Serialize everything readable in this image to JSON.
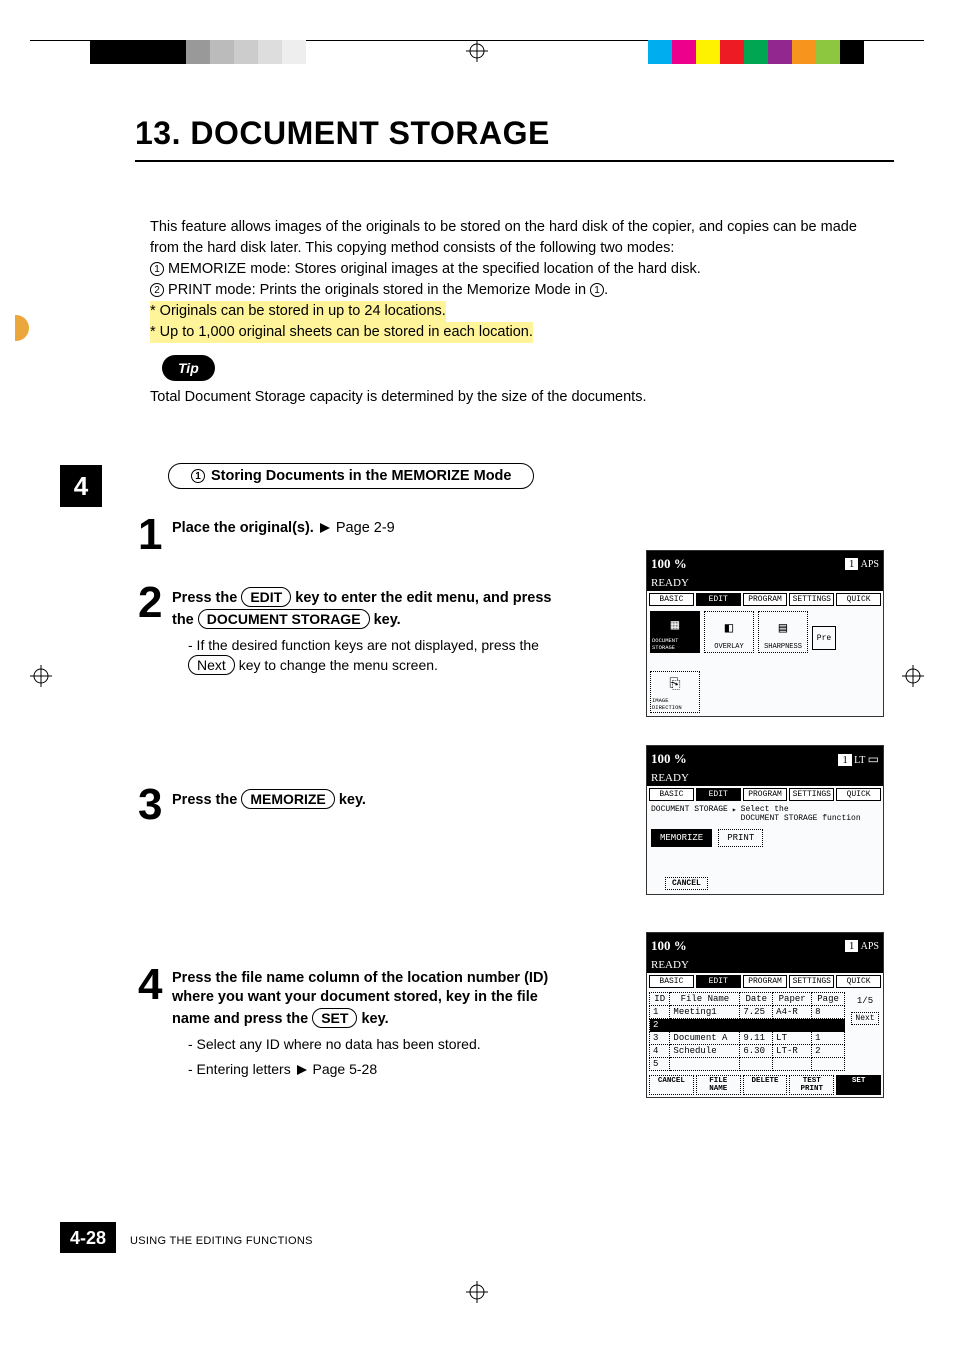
{
  "title": "13. DOCUMENT STORAGE",
  "intro": {
    "p1": "This feature allows images of the originals to be stored on the hard disk of the copier, and copies can be made from the hard disk later. This copying method consists of the following two modes:",
    "mode1": "MEMORIZE mode:  Stores original images at the specified location of the hard disk.",
    "mode2": "PRINT mode: Prints the originals stored in the Memorize Mode in",
    "note1": "* Originals can be stored in up to 24 locations.",
    "note2": "* Up to 1,000 original sheets can be stored in each location."
  },
  "tip": {
    "label": "Tip",
    "text": "Total Document Storage capacity is determined by the size of the documents."
  },
  "section_header": "Storing Documents in the MEMORIZE Mode",
  "chapter_tab": "4",
  "steps": {
    "s1": {
      "num": "1",
      "bold": "Place the original(s).",
      "ref": "Page 2-9"
    },
    "s2": {
      "num": "2",
      "line_a": "Press the",
      "key1": "EDIT",
      "line_b": "key to enter the edit menu, and press the",
      "key2": "DOCUMENT STORAGE",
      "line_c": "key.",
      "sub_a": "- If the desired function keys are not displayed, press the",
      "key3": "Next",
      "sub_b": "key to change the menu screen."
    },
    "s3": {
      "num": "3",
      "line_a": "Press the",
      "key1": "MEMORIZE",
      "line_b": "key."
    },
    "s4": {
      "num": "4",
      "line_a": "Press the  file name column of the location number (ID) where you want your document stored, key in the file name and press the",
      "key1": "SET",
      "line_b": "key.",
      "sub_a": "- Select any ID where no data has been stored.",
      "sub_b": "- Entering letters",
      "ref": "Page 5-28"
    }
  },
  "panels": {
    "common": {
      "zoom": "100  %",
      "count": "1",
      "ready": "READY",
      "tabs": [
        "BASIC",
        "EDIT",
        "PROGRAM",
        "SETTINGS",
        "QUICK"
      ]
    },
    "p2": {
      "paper": "APS",
      "icons": [
        "DOCUMENT STORAGE",
        "OVERLAY",
        "SHARPNESS"
      ],
      "pre": "Pre",
      "extra": "IMAGE DIRECTION"
    },
    "p3": {
      "paper": "LT",
      "breadcrumb": "DOCUMENT STORAGE",
      "hint1": "Select the",
      "hint2": "DOCUMENT STORAGE function",
      "btns": [
        "MEMORIZE",
        "PRINT"
      ],
      "cancel": "CANCEL"
    },
    "p4": {
      "paper": "APS",
      "headers": [
        "ID",
        "File Name",
        "Date",
        "Paper",
        "Page"
      ],
      "rows": [
        {
          "id": "1",
          "name": "Meeting1",
          "date": "7.25",
          "paper": "A4-R",
          "page": "8"
        },
        {
          "id": "2",
          "name": "",
          "date": "",
          "paper": "",
          "page": ""
        },
        {
          "id": "3",
          "name": "Document A",
          "date": "9.11",
          "paper": "LT",
          "page": "1"
        },
        {
          "id": "4",
          "name": "Schedule",
          "date": "6.30",
          "paper": "LT-R",
          "page": "2"
        },
        {
          "id": "5",
          "name": "",
          "date": "",
          "paper": "",
          "page": ""
        }
      ],
      "page_indicator": "1/5",
      "next": "Next",
      "bottom_btns": [
        "CANCEL",
        "FILE NAME",
        "DELETE",
        "TEST PRINT",
        "SET"
      ]
    }
  },
  "footer": {
    "page_num": "4-28",
    "section": "USING THE EDITING FUNCTIONS"
  },
  "reg_colors_right": [
    "#00aeef",
    "#ec008c",
    "#fff200",
    "#ed1c24",
    "#00a651",
    "#92278f",
    "#f7941d",
    "#8dc63f"
  ]
}
